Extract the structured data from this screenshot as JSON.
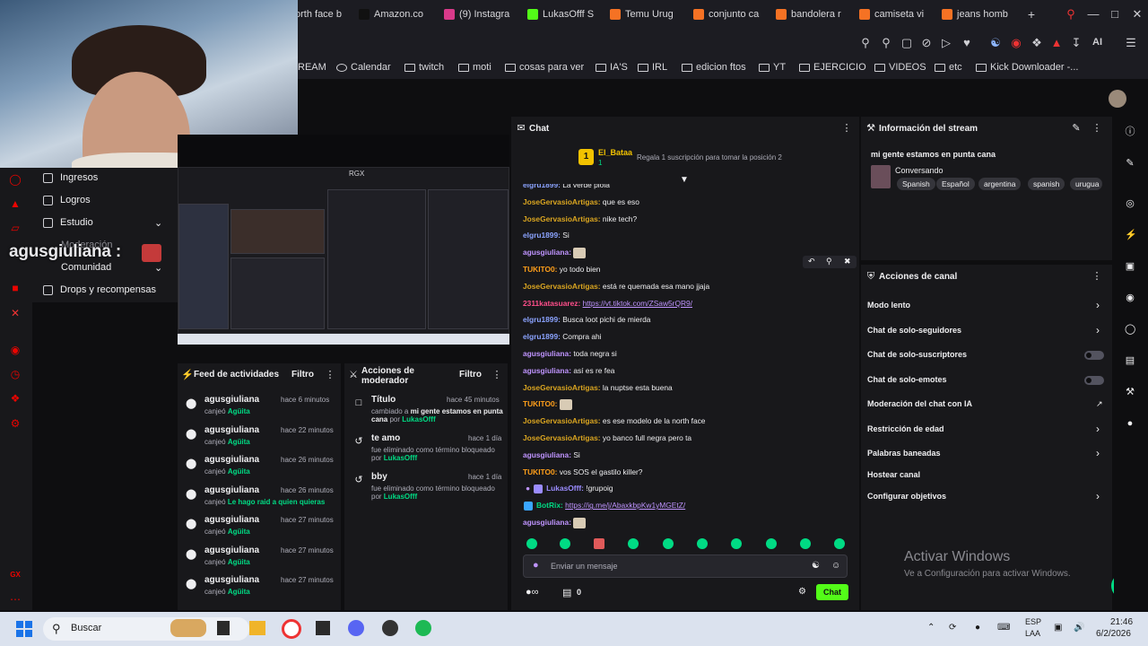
{
  "browser": {
    "tabs": [
      {
        "label": "orth face b",
        "color": "#e54f2d"
      },
      {
        "label": "Amazon.co",
        "color": "#111"
      },
      {
        "label": "(9) Instagra",
        "color": "#d83a8a"
      },
      {
        "label": "LukasOfff S",
        "color": "#53fc18"
      },
      {
        "label": "Temu Urug",
        "color": "#f57224"
      },
      {
        "label": "conjunto ca",
        "color": "#f57224"
      },
      {
        "label": "bandolera r",
        "color": "#f57224"
      },
      {
        "label": "camiseta vi",
        "color": "#f57224"
      },
      {
        "label": "jeans homb",
        "color": "#f57224"
      }
    ],
    "toolbar_right_label": "AI",
    "bookmarks": [
      "REAM",
      "Calendar",
      "twitch",
      "moti",
      "cosas para ver",
      "IA'S",
      "IRL",
      "edicion ftos",
      "YT",
      "EJERCICIO",
      "VIDEOS",
      "etc",
      "Kick Downloader -..."
    ]
  },
  "overlay": {
    "name": "agusgiuliana :"
  },
  "leftnav": {
    "items": [
      "Ingresos",
      "Logros",
      "Estudio",
      "Moderación",
      "Comunidad",
      "Drops y recompensas"
    ]
  },
  "preview": {
    "label": "RGX"
  },
  "activity": {
    "title": "Feed de actividades",
    "filter": "Filtro",
    "rows": [
      {
        "user": "agusgiuliana",
        "time": "hace 6 minutos",
        "prefix": "canjeó",
        "reward": "Agüita"
      },
      {
        "user": "agusgiuliana",
        "time": "hace 22 minutos",
        "prefix": "canjeó",
        "reward": "Agüita"
      },
      {
        "user": "agusgiuliana",
        "time": "hace 26 minutos",
        "prefix": "canjeó",
        "reward": "Agüita"
      },
      {
        "user": "agusgiuliana",
        "time": "hace 26 minutos",
        "prefix": "canjeó",
        "reward": "Le hago raid a quien quieras"
      },
      {
        "user": "agusgiuliana",
        "time": "hace 27 minutos",
        "prefix": "canjeó",
        "reward": "Agüita"
      },
      {
        "user": "agusgiuliana",
        "time": "hace 27 minutos",
        "prefix": "canjeó",
        "reward": "Agüita"
      },
      {
        "user": "agusgiuliana",
        "time": "hace 27 minutos",
        "prefix": "canjeó",
        "reward": "Agüita"
      }
    ]
  },
  "modactions": {
    "title": "Acciones de moderador",
    "filter": "Filtro",
    "rows": [
      {
        "head": "Título",
        "time": "hace 45 minutos",
        "line1": "cambiado a",
        "bold": "mi gente estamos en punta",
        "line2": "cana",
        "by": "por",
        "mod": "LukasOfff"
      },
      {
        "head": "te amo",
        "time": "hace 1 día",
        "line1": "fue eliminado como término bloqueado",
        "bold": "",
        "line2": "",
        "by": "por",
        "mod": "LukasOfff"
      },
      {
        "head": "bby",
        "time": "hace 1 día",
        "line1": "fue eliminado como término bloqueado",
        "bold": "",
        "line2": "",
        "by": "por",
        "mod": "LukasOfff"
      }
    ]
  },
  "chat": {
    "title": "Chat",
    "gift_user": "El_Bataa",
    "gift_count": "1",
    "gift_text": "Regala 1 suscripción para tomar la posición 2",
    "messages": [
      {
        "user": "elgru1899:",
        "color": "#8ba3ff",
        "text": "La verde piola"
      },
      {
        "user": "JoseGervasioArtigas:",
        "color": "#daa520",
        "text": "que es eso"
      },
      {
        "user": "JoseGervasioArtigas:",
        "color": "#daa520",
        "text": "nike tech?"
      },
      {
        "user": "elgru1899:",
        "color": "#8ba3ff",
        "text": "Si"
      },
      {
        "user": "agusgiuliana:",
        "color": "#bf94ff",
        "text": "",
        "emote": true
      },
      {
        "user": "TUKITO0:",
        "color": "#ff9f1a",
        "text": "yo todo bien"
      },
      {
        "user": "JoseGervasioArtigas:",
        "color": "#daa520",
        "text": "está re quemada esa mano jjaja"
      },
      {
        "user": "2311katasuarez:",
        "color": "#ff4f8b",
        "text": "https://vt.tiktok.com/ZSaw5rQR9/",
        "link": true
      },
      {
        "user": "elgru1899:",
        "color": "#8ba3ff",
        "text": "Busca loot pichi de mierda"
      },
      {
        "user": "elgru1899:",
        "color": "#8ba3ff",
        "text": "Compra ahi"
      },
      {
        "user": "agusgiuliana:",
        "color": "#bf94ff",
        "text": "toda negra si"
      },
      {
        "user": "agusgiuliana:",
        "color": "#bf94ff",
        "text": "así es re fea"
      },
      {
        "user": "JoseGervasioArtigas:",
        "color": "#daa520",
        "text": "la nuptse esta buena"
      },
      {
        "user": "TUKITO0:",
        "color": "#ff9f1a",
        "text": "",
        "emote": true
      },
      {
        "user": "JoseGervasioArtigas:",
        "color": "#daa520",
        "text": "es ese modelo de la north face"
      },
      {
        "user": "JoseGervasioArtigas:",
        "color": "#daa520",
        "text": "yo banco full negra pero ta"
      },
      {
        "user": "agusgiuliana:",
        "color": "#bf94ff",
        "text": "Si"
      },
      {
        "user": "TUKITO0:",
        "color": "#ff9f1a",
        "text": "vos SOS el gastilo killer?"
      },
      {
        "user": "LukasOfff:",
        "color": "#9b8cff",
        "text": "!grupoig"
      },
      {
        "user": "BotRix:",
        "color": "#00db84",
        "text": "https://ig.me/j/AbaxkbpKw1yMGEtZ/",
        "link": true
      },
      {
        "user": "agusgiuliana:",
        "color": "#bf94ff",
        "text": "",
        "emote": true
      }
    ],
    "input_placeholder": "Enviar un mensaje",
    "points": "0",
    "send_label": "Chat"
  },
  "stream_info": {
    "title": "Información del stream",
    "stream_title": "mi gente estamos en punta cana",
    "category": "Conversando",
    "tags": [
      "Spanish",
      "Español",
      "argentina",
      "spanish",
      "urugua"
    ]
  },
  "channel_actions": {
    "title": "Acciones de canal",
    "items": [
      {
        "label": "Modo lento",
        "control": "chevron"
      },
      {
        "label": "Chat de solo-seguidores",
        "control": "chevron"
      },
      {
        "label": "Chat de solo-suscriptores",
        "control": "toggle"
      },
      {
        "label": "Chat de solo-emotes",
        "control": "toggle"
      },
      {
        "label": "Moderación del chat con IA",
        "control": "external"
      },
      {
        "label": "Restricción de edad",
        "control": "chevron"
      },
      {
        "label": "Palabras baneadas",
        "control": "chevron"
      },
      {
        "label": "Hostear canal",
        "control": "none"
      },
      {
        "label": "Configurar objetivos",
        "control": "chevron"
      }
    ]
  },
  "watermark": {
    "line1": "Activar Windows",
    "line2": "Ve a Configuración para activar Windows."
  },
  "taskbar": {
    "search": "Buscar",
    "lang": "ESP",
    "lang2": "LAA",
    "time": "21:46",
    "date": "6/2/2026"
  },
  "colors": {
    "accent": "#53fc18",
    "gift": "#f2c200",
    "brand_red": "#eb0400"
  }
}
